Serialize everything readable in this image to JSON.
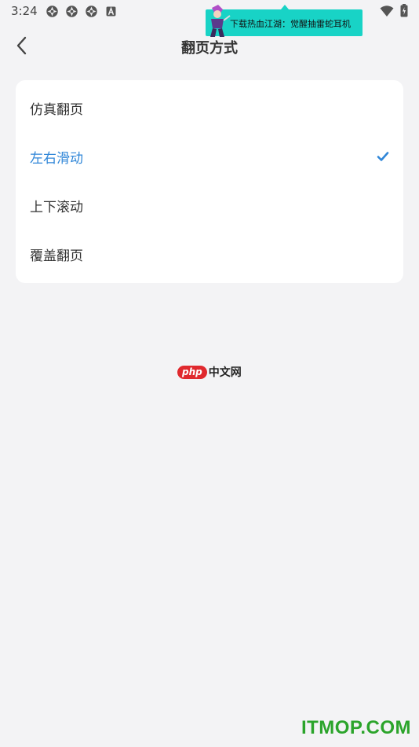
{
  "status_bar": {
    "time": "3:24",
    "left_icons": [
      "app-notification-icon",
      "app-notification-icon",
      "app-notification-icon",
      "a-notification-icon"
    ],
    "right_icons": [
      "wifi-icon",
      "battery-icon"
    ]
  },
  "ad": {
    "text": "下载热血江湖：觉醒抽雷蛇耳机",
    "color": "#18d3c6"
  },
  "header": {
    "back_icon": "chevron-left-icon",
    "title": "翻页方式"
  },
  "options": [
    {
      "label": "仿真翻页",
      "selected": false
    },
    {
      "label": "左右滑动",
      "selected": true
    },
    {
      "label": "上下滚动",
      "selected": false
    },
    {
      "label": "覆盖翻页",
      "selected": false
    }
  ],
  "accent_color": "#2f86d8",
  "logo": {
    "badge": "php",
    "text": "中文网"
  },
  "watermark": "ITMOP.COM"
}
